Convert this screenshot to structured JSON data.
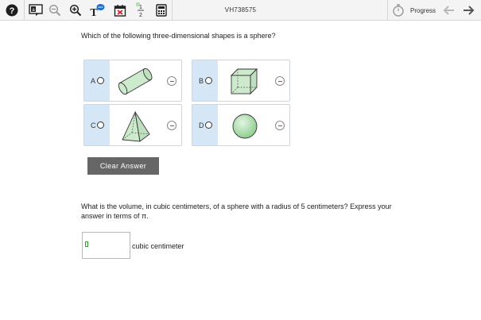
{
  "toolbar": {
    "item_id": "VH738575",
    "progress_label": "Progress",
    "calc_fraction_top": "1",
    "calc_fraction_bottom": "2",
    "text_icon_label": "T",
    "translate_icon_label": "a"
  },
  "question1": {
    "prompt": "Which of the following three-dimensional shapes is a sphere?",
    "options": [
      {
        "letter": "A",
        "shape": "cylinder-icon"
      },
      {
        "letter": "B",
        "shape": "cube-icon"
      },
      {
        "letter": "C",
        "shape": "pyramid-icon"
      },
      {
        "letter": "D",
        "shape": "sphere-icon"
      }
    ],
    "clear_label": "Clear Answer"
  },
  "question2": {
    "prompt": "What is the volume, in cubic centimeters, of a sphere with a radius of 5 centimeters? Express your answer in terms of π.",
    "answer_value": "",
    "unit_label": "cubic centimeter"
  },
  "colors": {
    "option_strip": "#d5e6f6",
    "shape_fill": "#cdeacd",
    "clear_button": "#666666"
  }
}
